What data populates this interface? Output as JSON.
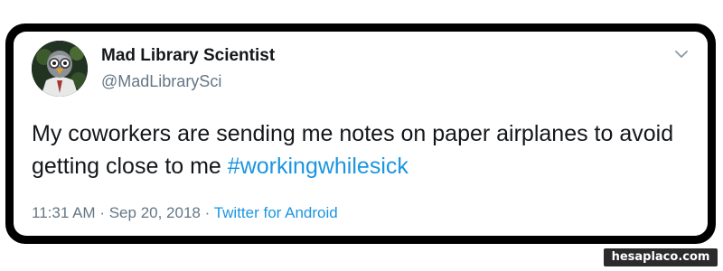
{
  "user": {
    "display_name": "Mad Library Scientist",
    "handle": "@MadLibrarySci"
  },
  "tweet": {
    "text": "My coworkers are sending me notes on paper airplanes to avoid getting close to me",
    "hashtag": "#workingwhilesick"
  },
  "meta": {
    "time": "11:31 AM",
    "separator": "·",
    "date": "Sep 20, 2018",
    "source": "Twitter for Android"
  },
  "icons": {
    "menu": "chevron-down-icon",
    "avatar": "avatar-image"
  },
  "colors": {
    "link": "#1b95e0",
    "secondary_text": "#657786",
    "primary_text": "#14171a"
  },
  "watermark": "hesaplaco.com"
}
